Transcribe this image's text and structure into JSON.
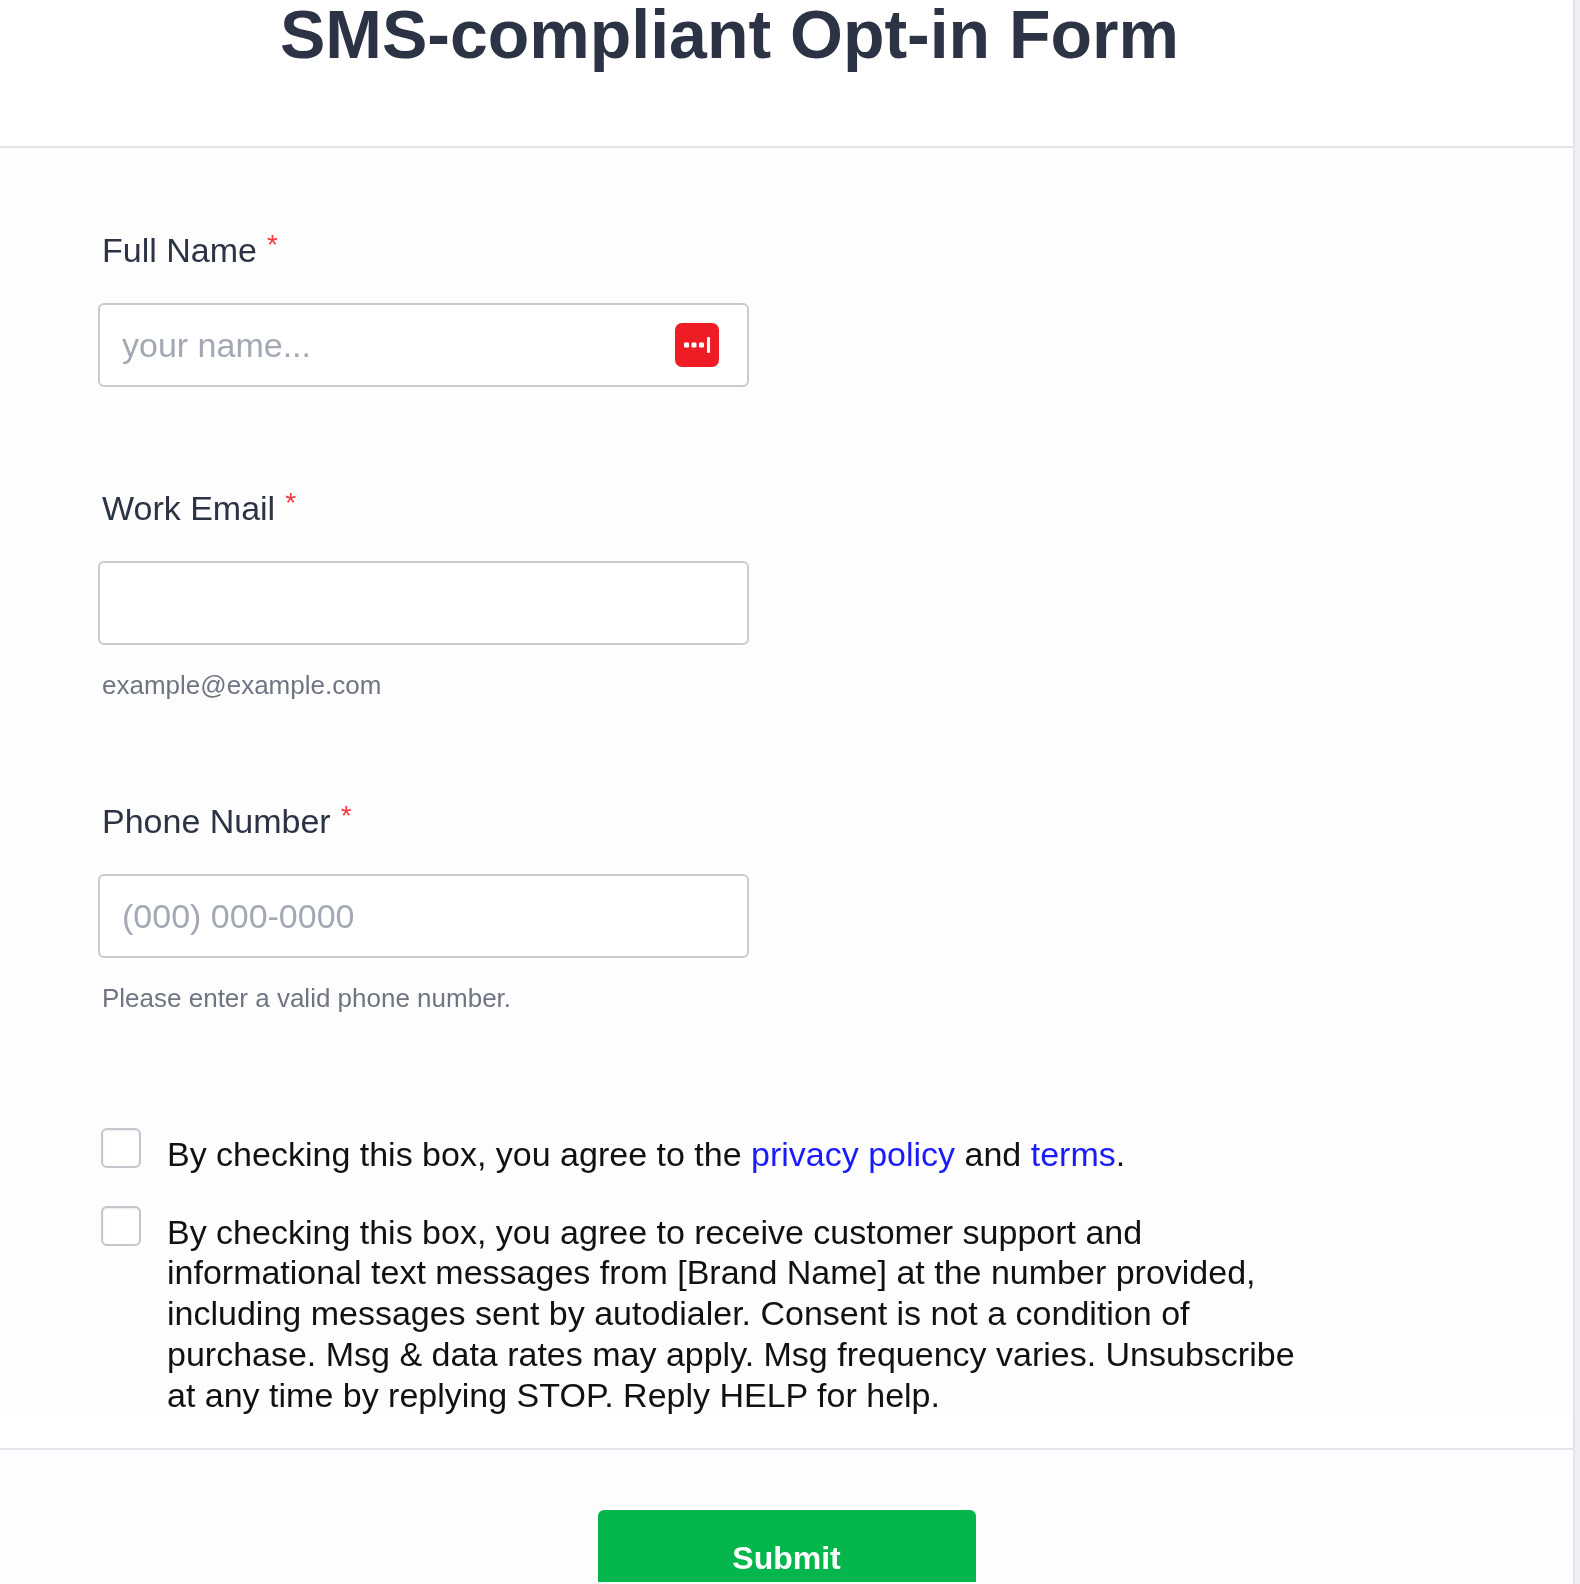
{
  "title": "SMS-compliant Opt-in Form",
  "fields": [
    {
      "label": "Full Name",
      "required_mark": "*",
      "placeholder": "your name...",
      "autofill_icon": true
    },
    {
      "label": "Work Email",
      "required_mark": "*",
      "hint": "example@example.com"
    },
    {
      "label": "Phone Number",
      "required_mark": "*",
      "placeholder": "(000) 000-0000",
      "hint": "Please enter a valid phone number."
    }
  ],
  "consents": [
    {
      "checked": false,
      "parts": [
        {
          "kind": "text",
          "text": "By checking this box, you agree to the "
        },
        {
          "kind": "link",
          "text": "privacy policy"
        },
        {
          "kind": "text",
          "text": " and "
        },
        {
          "kind": "link",
          "text": "terms"
        },
        {
          "kind": "text",
          "text": "."
        }
      ]
    },
    {
      "checked": false,
      "parts": [
        {
          "kind": "text",
          "text": "By checking this box, you agree to receive customer support and informational text messages from [Brand Name] at the number provided, including messages sent by autodialer. Consent is not a condition of purchase. Msg & data rates may apply. Msg frequency varies. Unsubscribe at any time by replying STOP. Reply HELP for help."
        }
      ]
    }
  ],
  "submit_button": {
    "label": "Submit"
  }
}
